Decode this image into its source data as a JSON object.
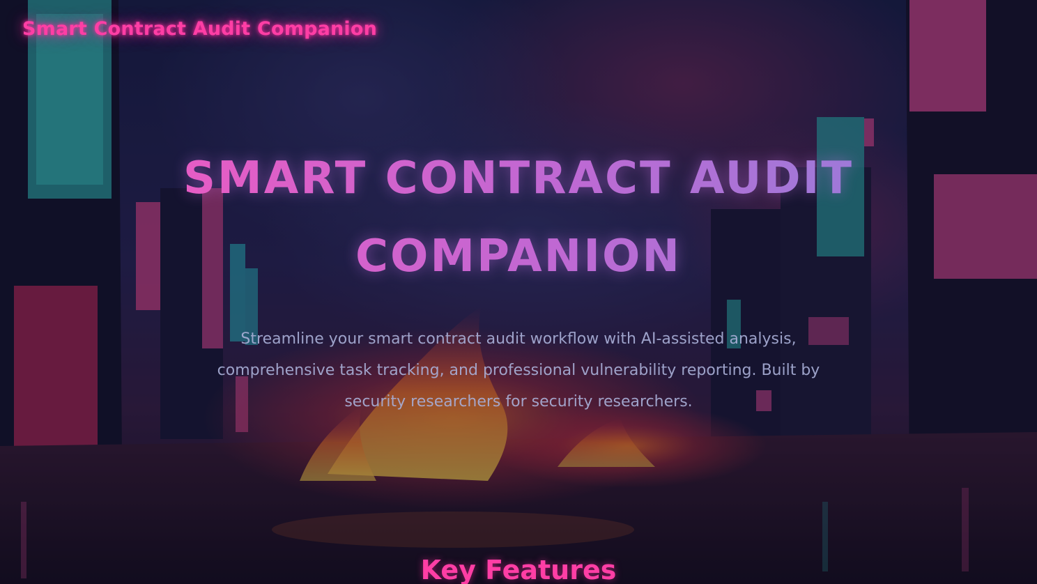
{
  "header": {
    "brand": "Smart Contract Audit Companion"
  },
  "hero": {
    "title": "SMART CONTRACT AUDIT COMPANION",
    "subtitle": "Streamline your smart contract audit workflow with AI-assisted analysis, comprehensive task tracking, and professional vulnerability reporting. Built by security researchers for security researchers."
  },
  "features": {
    "heading": "Key Features"
  },
  "theme": {
    "accent": "#ff3ea5",
    "title_gradient_start": "#e85cc4",
    "title_gradient_end": "#9d7ad9",
    "subtitle_color": "#a8aed6",
    "background": "#0d1024"
  },
  "background_image": "cyberpunk-city-street-fire-icon"
}
